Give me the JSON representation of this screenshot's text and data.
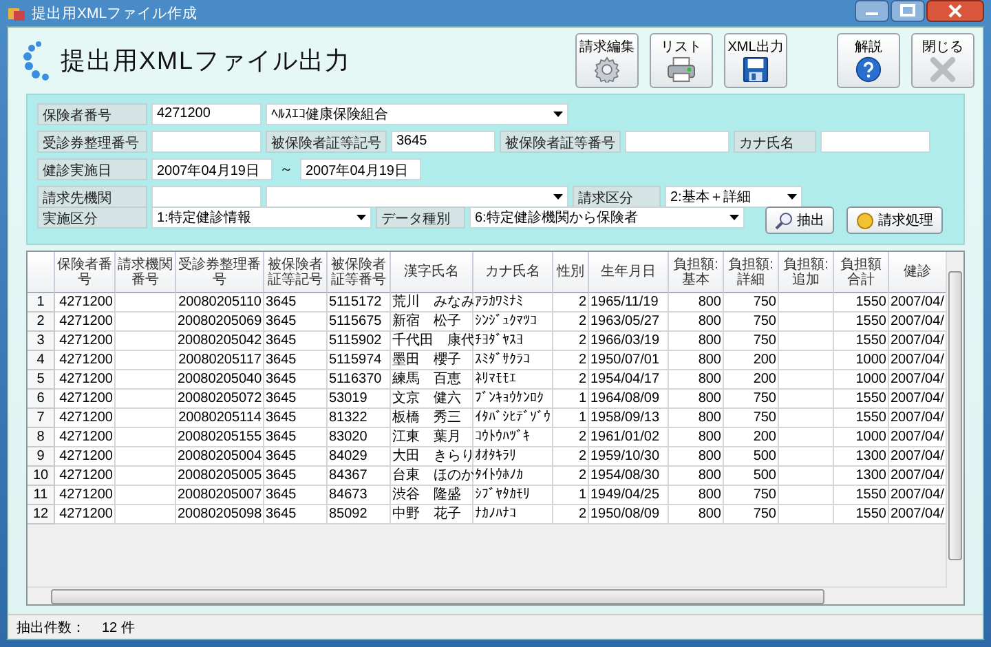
{
  "window": {
    "title": "提出用XMLファイル作成"
  },
  "header": {
    "title": "提出用XMLファイル出力",
    "buttons": [
      {
        "label": "請求編集",
        "kind": "gear"
      },
      {
        "label": "リスト",
        "kind": "printer"
      },
      {
        "label": "XML出力",
        "kind": "floppy"
      },
      {
        "label": "解説",
        "kind": "help"
      },
      {
        "label": "閉じる",
        "kind": "close"
      }
    ]
  },
  "form": {
    "items": [
      {
        "kind": "label",
        "text": "保険者番号"
      },
      {
        "kind": "text",
        "value": "4271200"
      },
      {
        "kind": "combo",
        "value": "ﾍﾙｽｴｺ健康保険組合"
      },
      {
        "kind": "label",
        "text": "受診券整理番号"
      },
      {
        "kind": "text"
      },
      {
        "kind": "label",
        "text": "被保険者証等記号"
      },
      {
        "kind": "text",
        "value": "3645"
      },
      {
        "kind": "label",
        "text": "被保険者証等番号"
      },
      {
        "kind": "text"
      },
      {
        "kind": "label",
        "text": "カナ氏名"
      },
      {
        "kind": "text"
      },
      {
        "kind": "label",
        "text": "健診実施日"
      },
      {
        "kind": "text",
        "value": "2007年04月19日"
      },
      {
        "kind": "sep",
        "text": "～"
      },
      {
        "kind": "text",
        "value": "2007年04月19日"
      },
      {
        "kind": "label",
        "text": "請求先機関"
      },
      {
        "kind": "text"
      },
      {
        "kind": "combo"
      },
      {
        "kind": "label",
        "text": "請求区分"
      },
      {
        "kind": "combo",
        "value": "2:基本＋詳細"
      },
      {
        "kind": "label",
        "text": "実施区分"
      },
      {
        "kind": "combo",
        "value": "1:特定健診情報"
      },
      {
        "kind": "label",
        "text": "データ種別"
      },
      {
        "kind": "combo",
        "value": "6:特定健診機関から保険者"
      },
      {
        "kind": "button",
        "label": "抽出"
      },
      {
        "kind": "button",
        "label": "請求処理"
      }
    ]
  },
  "table": {
    "columns": [
      "保険者番号",
      "請求機関番号",
      "受診券整理番号",
      "被保険者証等記号",
      "被保険者証等番号",
      "漢字氏名",
      "カナ氏名",
      "性別",
      "生年月日",
      "負担額:基本",
      "負担額:詳細",
      "負担額:追加",
      "負担額合計",
      "健診"
    ],
    "rows": [
      {
        "number": "1",
        "cells": [
          "4271200",
          "",
          "20080205110",
          "3645",
          "5115172",
          "荒川　みなみ",
          "ｱﾗｶﾜﾐﾅﾐ",
          "2",
          "1965/11/19",
          "800",
          "750",
          "",
          "1550",
          "2007/04/"
        ]
      },
      {
        "number": "2",
        "cells": [
          "4271200",
          "",
          "20080205069",
          "3645",
          "5115675",
          "新宿　松子",
          "ｼﾝｼﾞｭｸﾏﾂｺ",
          "2",
          "1963/05/27",
          "800",
          "750",
          "",
          "1550",
          "2007/04/"
        ]
      },
      {
        "number": "3",
        "cells": [
          "4271200",
          "",
          "20080205042",
          "3645",
          "5115902",
          "千代田　康代",
          "ﾁﾖﾀﾞﾔｽﾖ",
          "2",
          "1966/03/19",
          "800",
          "750",
          "",
          "1550",
          "2007/04/"
        ]
      },
      {
        "number": "4",
        "cells": [
          "4271200",
          "",
          "20080205117",
          "3645",
          "5115974",
          "墨田　櫻子",
          "ｽﾐﾀﾞｻｸﾗｺ",
          "2",
          "1950/07/01",
          "800",
          "200",
          "",
          "1000",
          "2007/04/"
        ]
      },
      {
        "number": "5",
        "cells": [
          "4271200",
          "",
          "20080205040",
          "3645",
          "5116370",
          "練馬　百恵",
          "ﾈﾘﾏﾓﾓｴ",
          "2",
          "1954/04/17",
          "800",
          "200",
          "",
          "1000",
          "2007/04/"
        ]
      },
      {
        "number": "6",
        "cells": [
          "4271200",
          "",
          "20080205072",
          "3645",
          "53019",
          "文京　健六",
          "ﾌﾞﾝｷｮｳｹﾝﾛｸ",
          "1",
          "1964/08/09",
          "800",
          "750",
          "",
          "1550",
          "2007/04/"
        ]
      },
      {
        "number": "7",
        "cells": [
          "4271200",
          "",
          "20080205114",
          "3645",
          "81322",
          "板橋　秀三",
          "ｲﾀﾊﾞｼﾋﾃﾞｿﾞｳ",
          "1",
          "1958/09/13",
          "800",
          "750",
          "",
          "1550",
          "2007/04/"
        ]
      },
      {
        "number": "8",
        "cells": [
          "4271200",
          "",
          "20080205155",
          "3645",
          "83020",
          "江東　葉月",
          "ｺｳﾄｳﾊﾂﾞｷ",
          "2",
          "1961/01/02",
          "800",
          "200",
          "",
          "1000",
          "2007/04/"
        ]
      },
      {
        "number": "9",
        "cells": [
          "4271200",
          "",
          "20080205004",
          "3645",
          "84029",
          "大田　きらり",
          "ｵｵﾀｷﾗﾘ",
          "2",
          "1959/10/30",
          "800",
          "500",
          "",
          "1300",
          "2007/04/"
        ]
      },
      {
        "number": "10",
        "cells": [
          "4271200",
          "",
          "20080205005",
          "3645",
          "84367",
          "台東　ほのか",
          "ﾀｲﾄｳﾎﾉｶ",
          "2",
          "1954/08/30",
          "800",
          "500",
          "",
          "1300",
          "2007/04/"
        ]
      },
      {
        "number": "11",
        "cells": [
          "4271200",
          "",
          "20080205007",
          "3645",
          "84673",
          "渋谷　隆盛",
          "ｼﾌﾞﾔﾀｶﾓﾘ",
          "1",
          "1949/04/25",
          "800",
          "750",
          "",
          "1550",
          "2007/04/"
        ]
      },
      {
        "number": "12",
        "cells": [
          "4271200",
          "",
          "20080205098",
          "3645",
          "85092",
          "中野　花子",
          "ﾅｶﾉﾊﾅｺ",
          "2",
          "1950/08/09",
          "800",
          "750",
          "",
          "1550",
          "2007/04/"
        ]
      }
    ]
  },
  "status_bar": {
    "label": "抽出件数：",
    "count": "12 件"
  }
}
